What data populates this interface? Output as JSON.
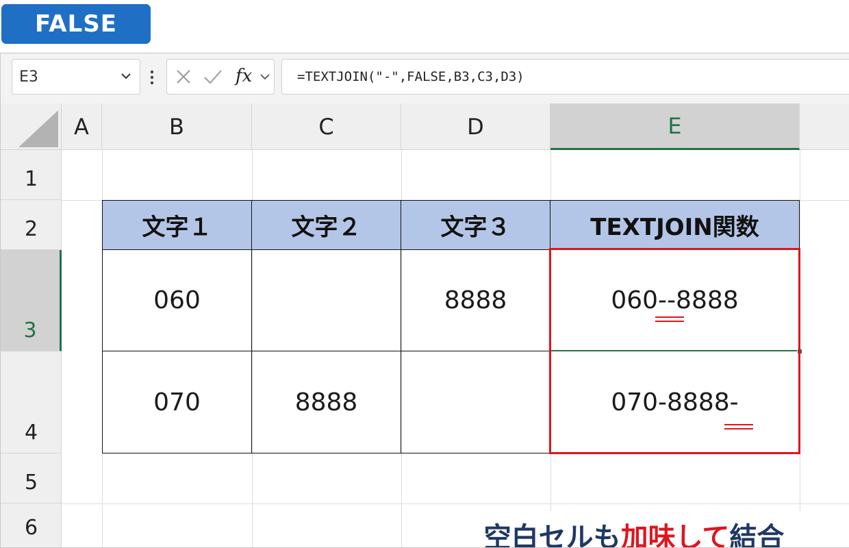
{
  "badge": {
    "label": "FALSE",
    "color": "#1f6fc5"
  },
  "formula_bar": {
    "name_box": "E3",
    "fx_label": "fx",
    "formula": "=TEXTJOIN(\"-\",FALSE,B3,C3,D3)"
  },
  "columns": [
    "A",
    "B",
    "C",
    "D",
    "E"
  ],
  "selected_column": "E",
  "rows": [
    "1",
    "2",
    "3",
    "4",
    "5",
    "6"
  ],
  "selected_row": "3",
  "table": {
    "headers": [
      "文字１",
      "文字２",
      "文字３",
      "TEXTJOIN関数"
    ],
    "rows": [
      [
        "060",
        "",
        "8888",
        "060--8888"
      ],
      [
        "070",
        "8888",
        "",
        "070-8888-"
      ]
    ],
    "header_fill": "#b4c6e7"
  },
  "caption": {
    "part1": "空白セルも",
    "highlight": "加味して",
    "part2": "結合",
    "color": "#1f3864",
    "highlight_color": "#e0141e"
  },
  "colors": {
    "accent_green": "#217346",
    "highlight_red": "#e0141e"
  }
}
